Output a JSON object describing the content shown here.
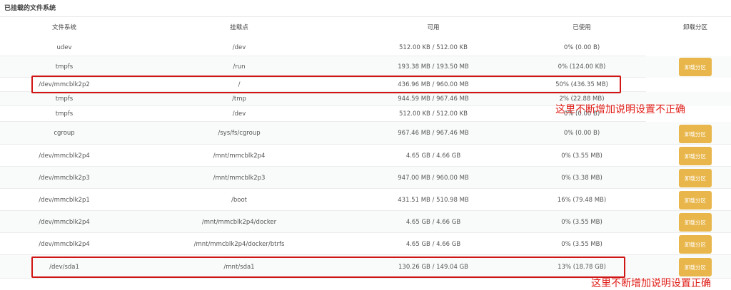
{
  "section_title": "已挂载的文件系统",
  "columns": [
    "文件系统",
    "挂载点",
    "可用",
    "已使用",
    "卸载分区"
  ],
  "unmount_label": "卸载分区",
  "rows": [
    {
      "fs": "udev",
      "mount": "/dev",
      "avail": "512.00 KB / 512.00 KB",
      "used": "0% (0.00 B)"
    },
    {
      "fs": "tmpfs",
      "mount": "/run",
      "avail": "193.38 MB / 193.50 MB",
      "used": "0% (124.00 KB)"
    },
    {
      "fs": "/dev/mmcblk2p2",
      "mount": "/",
      "avail": "436.96 MB / 960.00 MB",
      "used": "50% (436.35 MB)"
    },
    {
      "fs": "tmpfs",
      "mount": "/tmp",
      "avail": "944.59 MB / 967.46 MB",
      "used": "2% (22.88 MB)"
    },
    {
      "fs": "tmpfs",
      "mount": "/dev",
      "avail": "512.00 KB / 512.00 KB",
      "used": "0% (0.00 B)"
    },
    {
      "fs": "cgroup",
      "mount": "/sys/fs/cgroup",
      "avail": "967.46 MB / 967.46 MB",
      "used": "0% (0.00 B)"
    },
    {
      "fs": "/dev/mmcblk2p4",
      "mount": "/mnt/mmcblk2p4",
      "avail": "4.65 GB / 4.66 GB",
      "used": "0% (3.55 MB)"
    },
    {
      "fs": "/dev/mmcblk2p3",
      "mount": "/mnt/mmcblk2p3",
      "avail": "947.00 MB / 960.00 MB",
      "used": "0% (3.38 MB)"
    },
    {
      "fs": "/dev/mmcblk2p1",
      "mount": "/boot",
      "avail": "431.51 MB / 510.98 MB",
      "used": "16% (79.48 MB)"
    },
    {
      "fs": "/dev/mmcblk2p4",
      "mount": "/mnt/mmcblk2p4/docker",
      "avail": "4.65 GB / 4.66 GB",
      "used": "0% (3.55 MB)"
    },
    {
      "fs": "/dev/mmcblk2p4",
      "mount": "/mnt/mmcblk2p4/docker/btrfs",
      "avail": "4.65 GB / 4.66 GB",
      "used": "0% (3.55 MB)"
    },
    {
      "fs": "/dev/sda1",
      "mount": "/mnt/sda1",
      "avail": "130.26 GB / 149.04 GB",
      "used": "13% (18.78 GB)"
    }
  ],
  "annotations": {
    "incorrect": "这里不断增加说明设置不正确",
    "correct": "这里不断增加说明设置正确"
  },
  "colors": {
    "button": "#e8b64a",
    "highlight": "#d01515",
    "annotation": "#e0201a"
  }
}
